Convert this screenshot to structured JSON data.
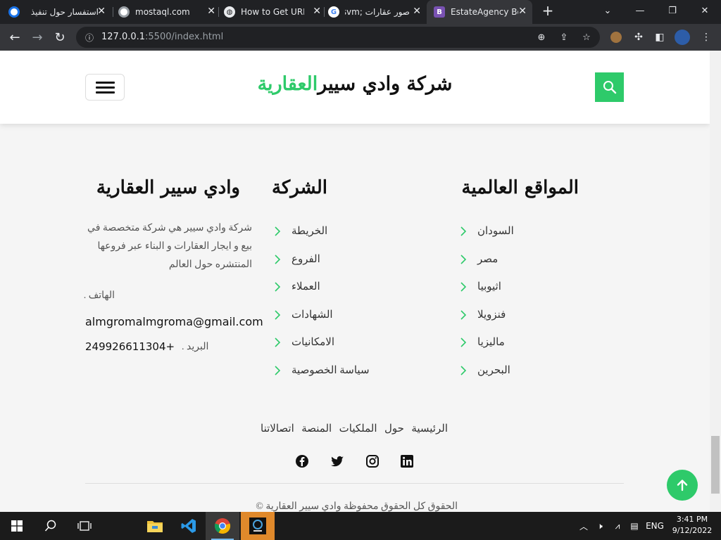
{
  "browser": {
    "tabs": [
      {
        "title": "استفسار حول تنفيذ",
        "icon": "blue-ring-icon"
      },
      {
        "title": "mostaql.com",
        "icon": "grey-ring-icon"
      },
      {
        "title": "How to Get URL",
        "icon": "globe-icon"
      },
      {
        "title": "صور عقارات ;svm",
        "icon": "google-icon"
      },
      {
        "title": "EstateAgency Bo",
        "icon": "bootstrap-icon"
      }
    ],
    "url_host": "127.0.0.1",
    "url_rest": ":5500/index.html"
  },
  "header": {
    "brand_main": "شركة وادي سيير",
    "brand_accent": "العقارية"
  },
  "footer": {
    "about": {
      "title": "وادي سيير العقارية",
      "text": "شركة وادي سيير هي شركة متخصصة في بيع و ايجار العقارات و البناء عبر فروعها المنتشره حول العالم",
      "phone_label": "الهاتف .",
      "email": "almgromalmgroma@gmail.com",
      "mail_label": "البريد .",
      "phone": "249926611304+"
    },
    "company": {
      "title": "الشركة",
      "items": [
        "الخريطة",
        "الفروع",
        "العملاء",
        "الشهادات",
        "الامكانيات",
        "سياسة الخصوصية"
      ]
    },
    "world": {
      "title": "المواقع العالمية",
      "items": [
        "السودان",
        "مصر",
        "اثيوبيا",
        "فنزويلا",
        "ماليزيا",
        "البحرين"
      ]
    },
    "bottom_nav": [
      "الرئيسية",
      "حول",
      "الملكيات",
      "المنصة",
      "اتصالاتنا"
    ],
    "social": [
      "facebook-icon",
      "twitter-icon",
      "instagram-icon",
      "linkedin-icon"
    ],
    "copyright": "الحقوق كل الحقوق محفوظة وادي سيير العقارية ©"
  },
  "colors": {
    "accent": "#2eca6a"
  },
  "system": {
    "lang": "ENG",
    "time": "3:41 PM",
    "date": "9/12/2022"
  }
}
